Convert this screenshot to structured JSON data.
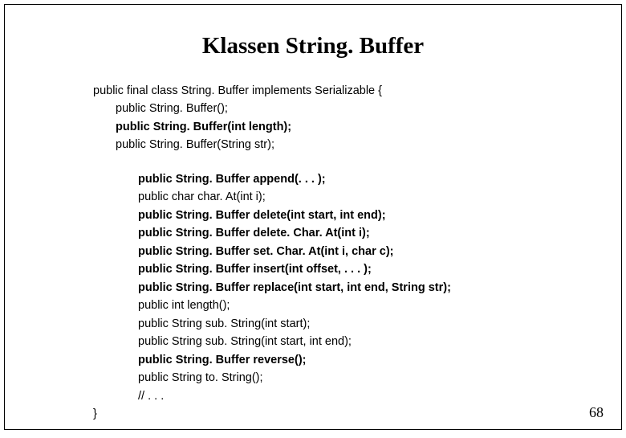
{
  "title": "Klassen String. Buffer",
  "lines": [
    {
      "text": "public final class String. Buffer implements Serializable {",
      "cls": ""
    },
    {
      "text": "public String. Buffer();",
      "cls": "indent1"
    },
    {
      "text": "public String. Buffer(int length);",
      "cls": "indent1 bold"
    },
    {
      "text": "public String. Buffer(String str);",
      "cls": "indent1"
    },
    {
      "text": "",
      "cls": "spacer"
    },
    {
      "text": "public String. Buffer append(. . . );",
      "cls": "indent2 bold"
    },
    {
      "text": "public char char. At(int i);",
      "cls": "indent2"
    },
    {
      "text": "public String. Buffer delete(int start, int end);",
      "cls": "indent2 bold"
    },
    {
      "text": "public String. Buffer delete. Char. At(int i);",
      "cls": "indent2 bold"
    },
    {
      "text": "public String. Buffer set. Char. At(int i, char c);",
      "cls": "indent2 bold"
    },
    {
      "text": "public String. Buffer insert(int offset, . . . );",
      "cls": "indent2 bold"
    },
    {
      "text": "public String. Buffer replace(int start, int end, String str);",
      "cls": "indent2 bold"
    },
    {
      "text": "public int length();",
      "cls": "indent2"
    },
    {
      "text": "public String sub. String(int start);",
      "cls": "indent2"
    },
    {
      "text": "public String sub. String(int start, int end);",
      "cls": "indent2"
    },
    {
      "text": "public String. Buffer reverse();",
      "cls": "indent2 bold"
    },
    {
      "text": "public String to. String();",
      "cls": "indent2"
    },
    {
      "text": "// . . .",
      "cls": "indent2"
    },
    {
      "text": "}",
      "cls": ""
    }
  ],
  "page_number": "68"
}
